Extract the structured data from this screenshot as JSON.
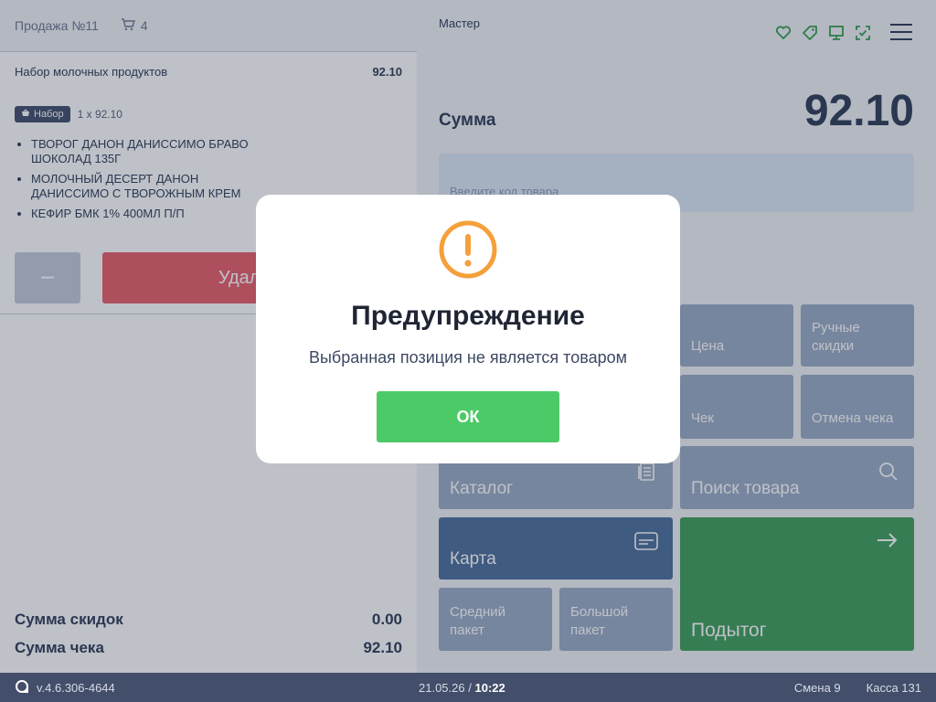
{
  "sale": {
    "title": "Продажа №11",
    "cart_count": "4"
  },
  "item": {
    "name": "Набор молочных продуктов",
    "price": "92.10",
    "badge": "Набор",
    "qty_price": "1 x 92.10",
    "components": [
      "ТВОРОГ ДАНОН ДАНИССИМО БРАВО ШОКОЛАД 135Г",
      "МОЛОЧНЫЙ ДЕСЕРТ ДАНОН ДАНИССИМО С ТВОРОЖНЫМ КРЕМ",
      "КЕФИР БМК 1% 400МЛ П/П"
    ],
    "minus_label": "−",
    "delete_label": "Удалить"
  },
  "totals": {
    "discount_label": "Сумма скидок",
    "discount_value": "0.00",
    "check_label": "Сумма чека",
    "check_value": "92.10"
  },
  "header": {
    "user": "Мастер",
    "icons": [
      "heart-icon",
      "tag-icon",
      "monitor-icon",
      "scan-icon",
      "menu-icon"
    ]
  },
  "sum": {
    "label": "Сумма",
    "value": "92.10"
  },
  "code_input": {
    "placeholder": "Введите код товара"
  },
  "tiles": {
    "price": "Цена",
    "manual_discounts": "Ручные скидки",
    "check": "Чек",
    "cancel_check": "Отмена чека",
    "catalog": "Каталог",
    "search": "Поиск товара",
    "card": "Карта",
    "medium_bag": "Средний пакет",
    "big_bag": "Большой пакет",
    "subtotal": "Подытог"
  },
  "dialog": {
    "title": "Предупреждение",
    "message": "Выбранная позиция не является товаром",
    "ok_label": "ОК"
  },
  "status": {
    "version": "v.4.6.306-4644",
    "date": "21.05.26",
    "separator": "/",
    "time": "10:22",
    "shift": "Смена 9",
    "register": "Касса 131"
  },
  "colors": {
    "accent_green": "#4cca67",
    "icon_green": "#2e9e4c",
    "delete_red": "#e85c69",
    "card_blue": "#4a6e9b",
    "subtotal_green": "#3d9e5a",
    "warning_orange": "#f5a03a",
    "statusbar": "#424e6a"
  }
}
